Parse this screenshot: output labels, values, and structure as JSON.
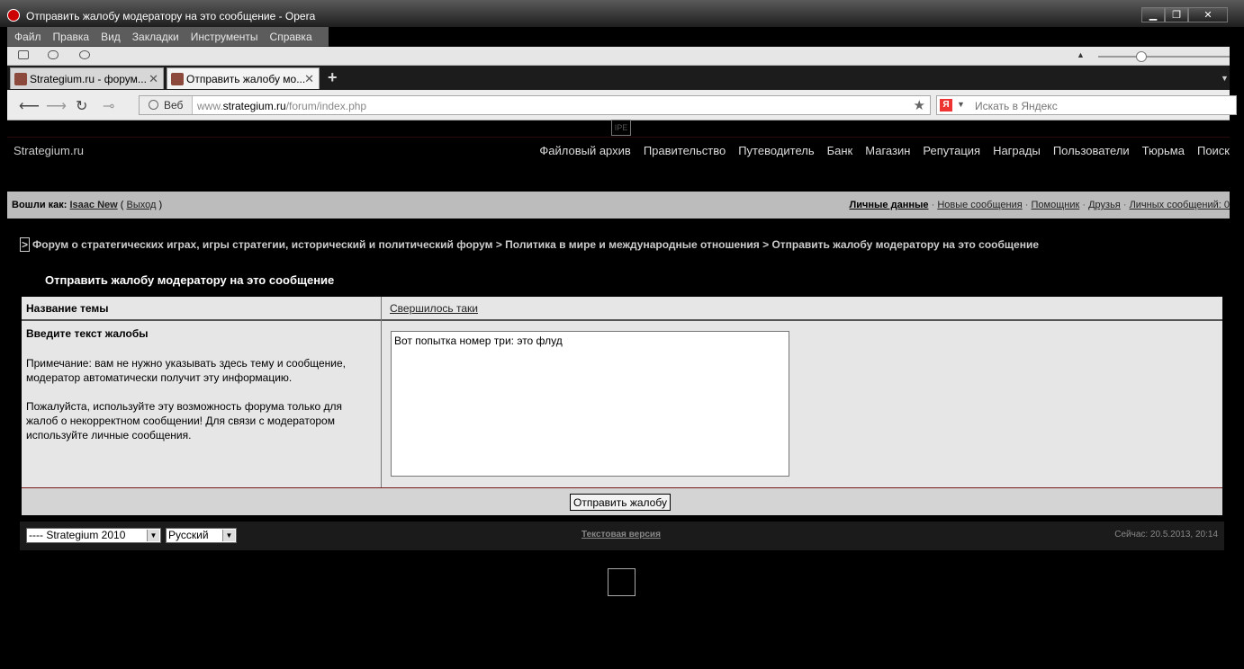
{
  "window": {
    "title": "Отправить жалобу модератору на это сообщение - Opera",
    "minimize": "▁",
    "restore": "❐",
    "close": "✕"
  },
  "menu": [
    "Файл",
    "Правка",
    "Вид",
    "Закладки",
    "Инструменты",
    "Справка"
  ],
  "tabs": [
    {
      "label": "Strategium.ru - форум...",
      "close": "✕"
    },
    {
      "label": "Отправить жалобу мо...",
      "close": "✕"
    }
  ],
  "tabbar": {
    "new_tab": "+",
    "menu": "▼"
  },
  "address": {
    "back": "⟵",
    "forward": "⟶",
    "reload": "↻",
    "key": "⊸",
    "web_label": "Веб",
    "url_prefix": "www.",
    "url_host": "strategium.ru",
    "url_path": "/forum/index.php",
    "star": "★"
  },
  "search": {
    "engine_letter": "Я",
    "dropdown": "▼",
    "placeholder": "Искать в Яндекс"
  },
  "toolbar": {
    "up": "▲"
  },
  "page": {
    "ipe": "IPE",
    "brand": "Strategium.ru",
    "topnav": [
      "Файловый архив",
      "Правительство",
      "Путеводитель",
      "Банк",
      "Магазин",
      "Репутация",
      "Награды",
      "Пользователи",
      "Тюрьма",
      "Поиск"
    ],
    "userbar": {
      "logged_as": "Вошли как:",
      "username": "Isaac New",
      "logout_open": "(",
      "logout": "Выход",
      "logout_close": ")",
      "links": [
        "Личные данные",
        "Новые сообщения",
        "Помощник",
        "Друзья",
        "Личных сообщений: 0"
      ],
      "sep": "·"
    },
    "breadcrumbs": {
      "marker": ">",
      "text": "Форум о стратегических играх, игры стратегии, исторический и политический форум > Политика в мире и международные отношения > Отправить жалобу модератору на это сообщение"
    },
    "form": {
      "title": "Отправить жалобу модератору на это сообщение",
      "topic_label": "Название темы",
      "topic_value": "Свершилось таки",
      "enter_label": "Введите текст жалобы",
      "note1": "Примечание: вам не нужно указывать здесь тему и сообщение, модератор автоматически получит эту информацию.",
      "note2": "Пожалуйста, используйте эту возможность форума только для жалоб о некорректном сообщении! Для связи с модератором используйте личные сообщения.",
      "complaint_text": "Вот попытка номер три: это флуд",
      "submit": "Отправить жалобу"
    },
    "footer": {
      "skin": "---- Strategium 2010",
      "language": "Русский",
      "dropdown": "▼",
      "text_version": "Текстовая версия",
      "now": "Сейчас: 20.5.2013, 20:14"
    }
  }
}
